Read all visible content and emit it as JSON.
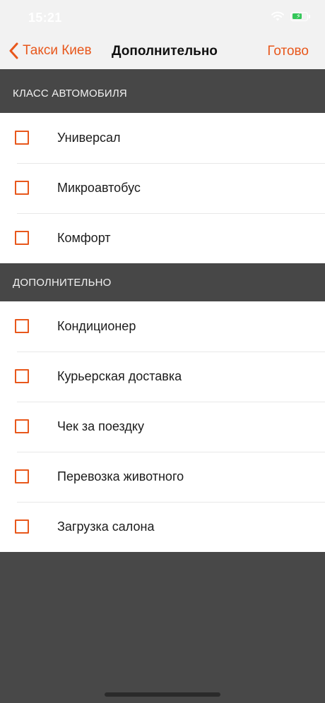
{
  "status_bar": {
    "time": "15:21"
  },
  "nav": {
    "back_label": "Такси Киев",
    "title": "Дополнительно",
    "done_label": "Готово"
  },
  "colors": {
    "accent": "#e8571b",
    "header_bg": "#474747",
    "battery_fill": "#34c759"
  },
  "sections": [
    {
      "header": "КЛАСС АВТОМОБИЛЯ",
      "items": [
        {
          "label": "Универсал",
          "checked": false
        },
        {
          "label": "Микроавтобус",
          "checked": false
        },
        {
          "label": "Комфорт",
          "checked": false
        }
      ]
    },
    {
      "header": "ДОПОЛНИТЕЛЬНО",
      "items": [
        {
          "label": "Кондиционер",
          "checked": false
        },
        {
          "label": "Курьерская доставка",
          "checked": false
        },
        {
          "label": "Чек за поездку",
          "checked": false
        },
        {
          "label": "Перевозка животного",
          "checked": false
        },
        {
          "label": "Загрузка салона",
          "checked": false
        }
      ]
    }
  ]
}
